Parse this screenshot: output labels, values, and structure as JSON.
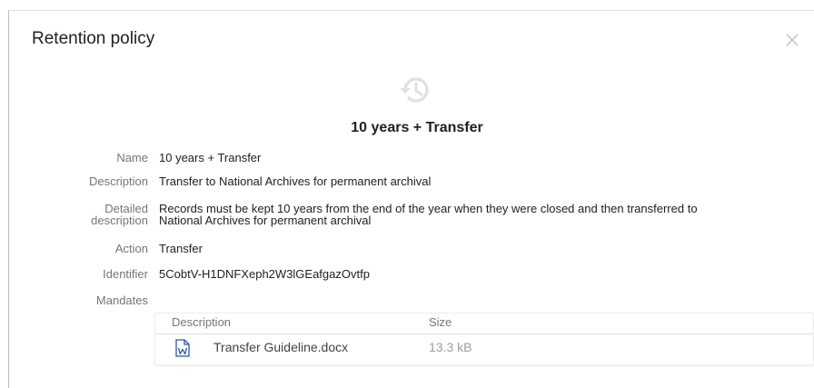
{
  "dialog": {
    "title": "Retention policy",
    "close_icon": "close-icon",
    "hero_icon": "history-icon",
    "policy_name": "10 years + Transfer"
  },
  "fields": {
    "name": {
      "label": "Name",
      "value": "10 years + Transfer"
    },
    "description": {
      "label": "Description",
      "value": "Transfer to National Archives for permanent archival"
    },
    "detailed_description": {
      "label_line1": "Detailed",
      "label_line2": "description",
      "value_line1": "Records must be kept 10 years from the end of the year when they were closed and then transferred to",
      "value_line2": "National Archives for permanent archival"
    },
    "action": {
      "label": "Action",
      "value": "Transfer"
    },
    "identifier": {
      "label": "Identifier",
      "value": "5CobtV-H1DNFXeph2W3lGEafgazOvtfp"
    },
    "mandates": {
      "label": "Mandates"
    }
  },
  "mandates_table": {
    "columns": {
      "description": "Description",
      "size": "Size"
    },
    "rows": [
      {
        "icon": "word-document-icon",
        "name": "Transfer Guideline.docx",
        "size": "13.3 kB"
      }
    ]
  },
  "colors": {
    "icon_gray": "#e0e0e0",
    "label_gray": "#757575",
    "word_blue": "#2b579a"
  }
}
